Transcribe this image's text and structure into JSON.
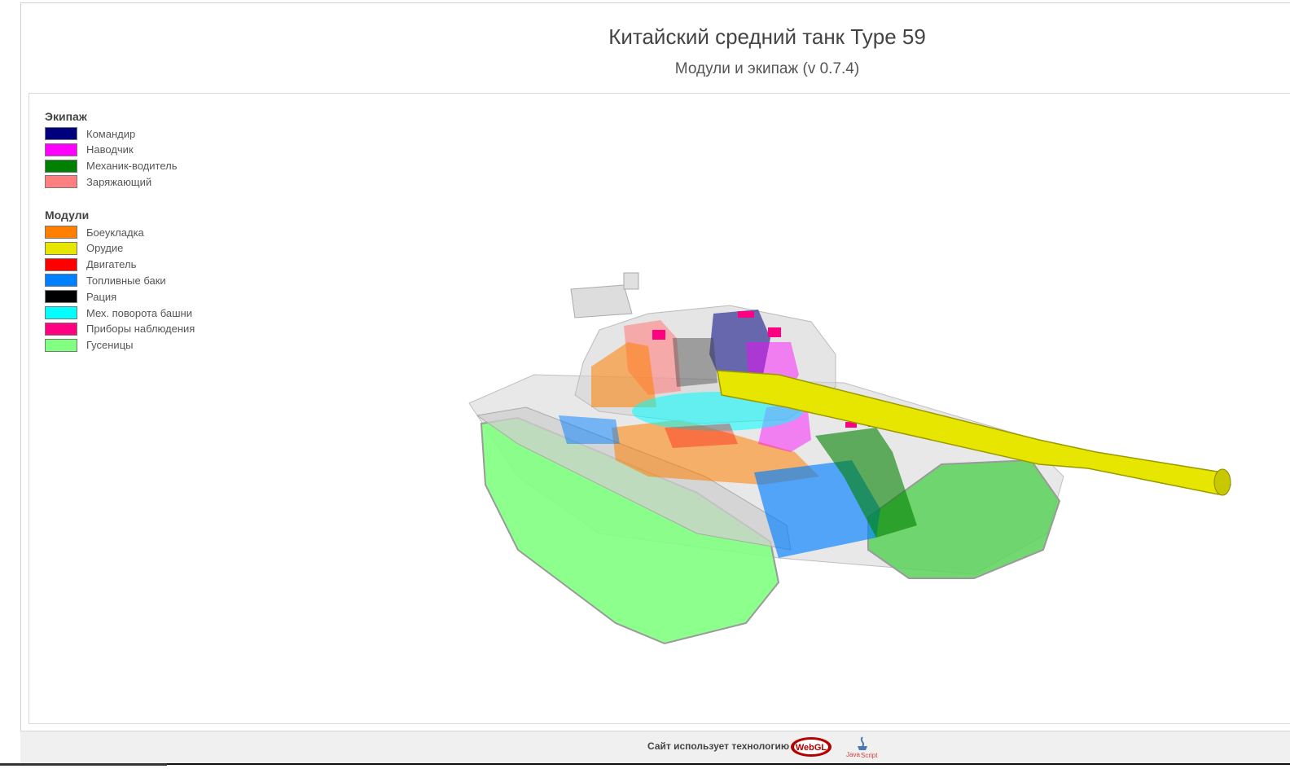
{
  "header": {
    "title": "Китайский средний танк Type 59",
    "subtitle": "Модули и экипаж (v 0.7.4)"
  },
  "legend": {
    "crew_heading": "Экипаж",
    "crew": [
      {
        "label": "Командир",
        "color": "#00007f"
      },
      {
        "label": "Наводчик",
        "color": "#ff00ff"
      },
      {
        "label": "Механик-водитель",
        "color": "#008000"
      },
      {
        "label": "Заряжающий",
        "color": "#ff8080"
      }
    ],
    "modules_heading": "Модули",
    "modules": [
      {
        "label": "Боеукладка",
        "color": "#ff8000"
      },
      {
        "label": "Орудие",
        "color": "#e6e600"
      },
      {
        "label": "Двигатель",
        "color": "#ff0000"
      },
      {
        "label": "Топливные баки",
        "color": "#0080ff"
      },
      {
        "label": "Рация",
        "color": "#000000"
      },
      {
        "label": "Мех. поворота башни",
        "color": "#00ffff"
      },
      {
        "label": "Приборы наблюдения",
        "color": "#ff0080"
      },
      {
        "label": "Гусеницы",
        "color": "#80ff80"
      }
    ]
  },
  "footer": {
    "text": "Сайт использует технологию",
    "webgl_logo": "WebGL",
    "js_logo_top": "Java",
    "js_logo_bottom": "Script"
  },
  "icons": {
    "tank_model": "tank-3d-model-render",
    "webgl": "webgl-logo",
    "javascript": "javascript-logo"
  }
}
